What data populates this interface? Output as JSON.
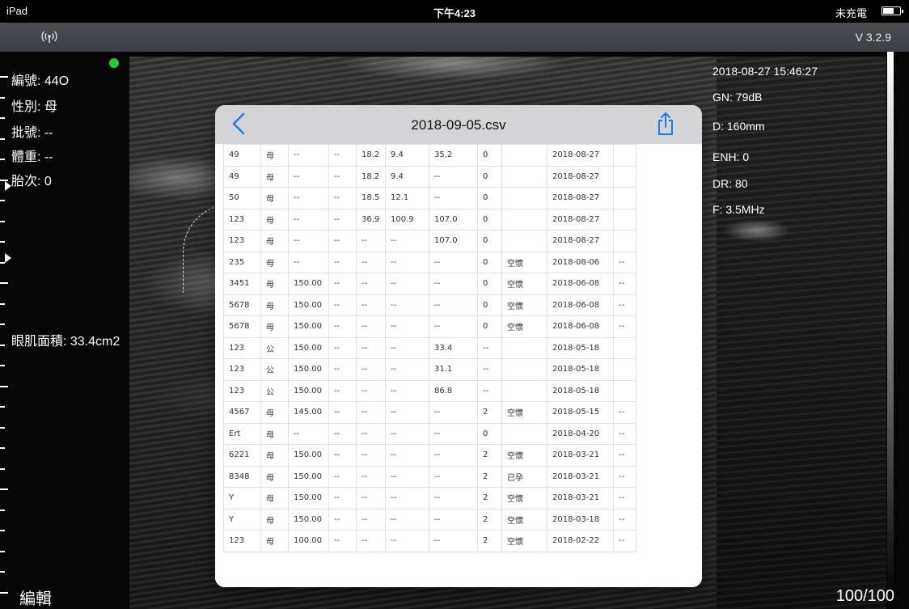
{
  "status_bar": {
    "device": "iPad",
    "time": "下午4:23",
    "charging": "未充電"
  },
  "app_bar": {
    "version": "V 3.2.9",
    "signal_icon": "wireless-signal-icon"
  },
  "scan": {
    "left_info": {
      "id": "編號: 44O",
      "sex": "性別: 母",
      "batch": "批號: --",
      "weight": "體重: --",
      "parity": "胎次: 0",
      "loin_area": "眼肌面積: 33.4cm2"
    },
    "right_info": {
      "datetime": "2018-08-27 15:46:27",
      "gain": "GN: 79dB",
      "depth": "D: 160mm",
      "enhance": "ENH: 0",
      "dynamic_range": "DR: 80",
      "frequency": "F: 3.5MHz"
    },
    "edit_label": "編輯",
    "page_counter": "100/100",
    "status_color": "#1dd32a"
  },
  "modal": {
    "title": "2018-09-05.csv",
    "back_icon": "chevron-left-icon",
    "share_icon": "share-icon",
    "accent_color": "#1a7cf5",
    "rows": [
      [
        "49",
        "母",
        "--",
        "--",
        "18.2",
        "9.4",
        "35.2",
        "0",
        "",
        "2018-08-27",
        ""
      ],
      [
        "49",
        "母",
        "--",
        "--",
        "18.2",
        "9.4",
        "--",
        "0",
        "",
        "2018-08-27",
        ""
      ],
      [
        "50",
        "母",
        "--",
        "--",
        "18.5",
        "12.1",
        "--",
        "0",
        "",
        "2018-08-27",
        ""
      ],
      [
        "123",
        "母",
        "--",
        "--",
        "36.9",
        "100.9",
        "107.0",
        "0",
        "",
        "2018-08-27",
        ""
      ],
      [
        "123",
        "母",
        "--",
        "--",
        "--",
        "--",
        "107.0",
        "0",
        "",
        "2018-08-27",
        ""
      ],
      [
        "235",
        "母",
        "--",
        "--",
        "--",
        "--",
        "--",
        "0",
        "空懷",
        "2018-08-06",
        "--"
      ],
      [
        "3451",
        "母",
        "150.00",
        "--",
        "--",
        "--",
        "--",
        "0",
        "空懷",
        "2018-06-08",
        "--"
      ],
      [
        "5678",
        "母",
        "150.00",
        "--",
        "--",
        "--",
        "--",
        "0",
        "空懷",
        "2018-06-08",
        "--"
      ],
      [
        "5678",
        "母",
        "150.00",
        "--",
        "--",
        "--",
        "--",
        "0",
        "空懷",
        "2018-06-08",
        "--"
      ],
      [
        "123",
        "公",
        "150.00",
        "--",
        "--",
        "--",
        "33.4",
        "--",
        "",
        "2018-05-18",
        ""
      ],
      [
        "123",
        "公",
        "150.00",
        "--",
        "--",
        "--",
        "31.1",
        "--",
        "",
        "2018-05-18",
        ""
      ],
      [
        "123",
        "公",
        "150.00",
        "--",
        "--",
        "--",
        "86.8",
        "--",
        "",
        "2018-05-18",
        ""
      ],
      [
        "4567",
        "母",
        "145.00",
        "--",
        "--",
        "--",
        "--",
        "2",
        "空懷",
        "2018-05-15",
        "--"
      ],
      [
        "Ert",
        "母",
        "--",
        "--",
        "--",
        "--",
        "--",
        "0",
        "",
        "2018-04-20",
        "--"
      ],
      [
        "6221",
        "母",
        "150.00",
        "--",
        "--",
        "--",
        "--",
        "2",
        "空懷",
        "2018-03-21",
        "--"
      ],
      [
        "8348",
        "母",
        "150.00",
        "--",
        "--",
        "--",
        "--",
        "2",
        "已孕",
        "2018-03-21",
        "--"
      ],
      [
        "Y",
        "母",
        "150.00",
        "--",
        "--",
        "--",
        "--",
        "2",
        "空懷",
        "2018-03-21",
        "--"
      ],
      [
        "Y",
        "母",
        "150.00",
        "--",
        "--",
        "--",
        "--",
        "2",
        "空懷",
        "2018-03-18",
        "--"
      ],
      [
        "123",
        "母",
        "100.00",
        "--",
        "--",
        "--",
        "--",
        "2",
        "空懷",
        "2018-02-22",
        "--"
      ]
    ]
  }
}
